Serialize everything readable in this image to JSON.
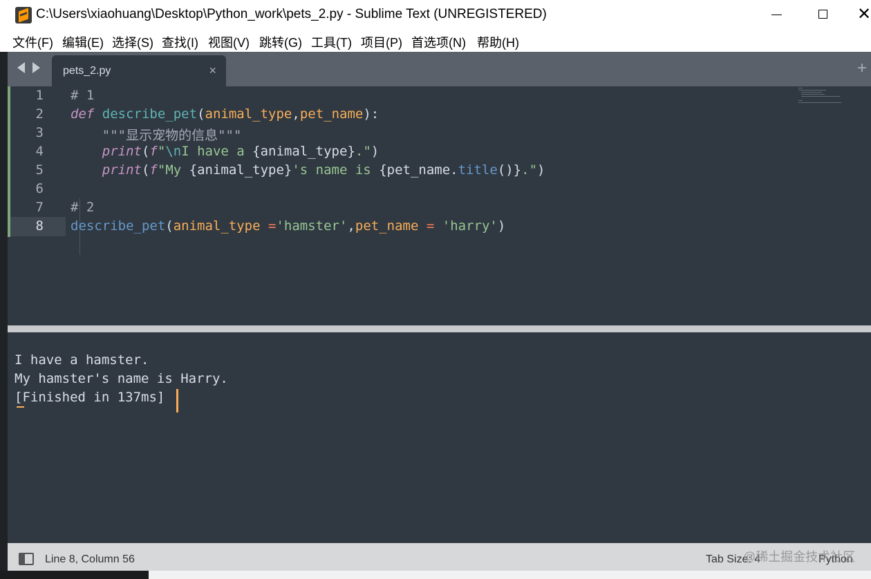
{
  "window": {
    "title": "C:\\Users\\xiaohuang\\Desktop\\Python_work\\pets_2.py - Sublime Text (UNREGISTERED)",
    "minimize_glyph": "—",
    "maximize_glyph": "□",
    "close_glyph": "✕"
  },
  "menu": [
    "文件(F)",
    "编辑(E)",
    "选择(S)",
    "查找(I)",
    "视图(V)",
    "跳转(G)",
    "工具(T)",
    "项目(P)",
    "首选项(N)",
    "帮助(H)"
  ],
  "tabs": {
    "active_label": "pets_2.py",
    "close_glyph": "×",
    "new_tab_glyph": "+"
  },
  "editor": {
    "line_numbers": [
      "1",
      "2",
      "3",
      "4",
      "5",
      "6",
      "7",
      "8"
    ],
    "active_line": 8,
    "lines": [
      [
        {
          "t": "# 1",
          "c": "cmt"
        }
      ],
      [
        {
          "t": "def",
          "c": "def"
        },
        {
          "t": " ",
          "c": "plain"
        },
        {
          "t": "describe_pet",
          "c": "fn"
        },
        {
          "t": "(",
          "c": "plain"
        },
        {
          "t": "animal_type",
          "c": "arg"
        },
        {
          "t": ",",
          "c": "plain"
        },
        {
          "t": "pet_name",
          "c": "arg"
        },
        {
          "t": "):",
          "c": "plain"
        }
      ],
      [
        {
          "t": "    \"\"\"显示宠物的信息\"\"\"",
          "c": "cmt"
        }
      ],
      [
        {
          "t": "    ",
          "c": "plain"
        },
        {
          "t": "print",
          "c": "print"
        },
        {
          "t": "(",
          "c": "plain"
        },
        {
          "t": "f",
          "c": "f"
        },
        {
          "t": "\"",
          "c": "str"
        },
        {
          "t": "\\n",
          "c": "esc"
        },
        {
          "t": "I have a ",
          "c": "str"
        },
        {
          "t": "{animal_type}",
          "c": "ph"
        },
        {
          "t": ".\"",
          "c": "str"
        },
        {
          "t": ")",
          "c": "plain"
        }
      ],
      [
        {
          "t": "    ",
          "c": "plain"
        },
        {
          "t": "print",
          "c": "print"
        },
        {
          "t": "(",
          "c": "plain"
        },
        {
          "t": "f",
          "c": "f"
        },
        {
          "t": "\"My ",
          "c": "str"
        },
        {
          "t": "{animal_type}",
          "c": "ph"
        },
        {
          "t": "'s name is ",
          "c": "str"
        },
        {
          "t": "{pet_name.",
          "c": "ph"
        },
        {
          "t": "title",
          "c": "meth"
        },
        {
          "t": "()}",
          "c": "ph"
        },
        {
          "t": ".\"",
          "c": "str"
        },
        {
          "t": ")",
          "c": "plain"
        }
      ],
      [],
      [
        {
          "t": "# 2",
          "c": "cmt"
        }
      ],
      [
        {
          "t": "describe_pet",
          "c": "meth"
        },
        {
          "t": "(",
          "c": "plain"
        },
        {
          "t": "animal_type",
          "c": "arg"
        },
        {
          "t": " ",
          "c": "plain"
        },
        {
          "t": "=",
          "c": "op"
        },
        {
          "t": "'hamster'",
          "c": "str"
        },
        {
          "t": ",",
          "c": "plain"
        },
        {
          "t": "pet_name",
          "c": "arg"
        },
        {
          "t": " ",
          "c": "plain"
        },
        {
          "t": "=",
          "c": "op"
        },
        {
          "t": " ",
          "c": "plain"
        },
        {
          "t": "'harry'",
          "c": "str"
        },
        {
          "t": ")",
          "c": "plain"
        }
      ]
    ]
  },
  "output": {
    "lines": [
      "I have a hamster.",
      "My hamster's name is Harry.",
      "[Finished in 137ms]"
    ]
  },
  "status": {
    "position": "Line 8, Column 56",
    "tab_size": "Tab Size: 4",
    "syntax": "Python",
    "watermark": "@稀土掘金技术社区"
  },
  "colors": {
    "editor_bg": "#303841",
    "tabbar_bg": "#5a616a",
    "accent_cursor": "#f9ae58",
    "keyword": "#c695c6",
    "function": "#5fb4b4",
    "argument": "#f9ae58",
    "string": "#99c794",
    "comment": "#a6acb9",
    "operator": "#f97b58",
    "method": "#6699cc"
  },
  "icons": {
    "app": "sublime-text-icon",
    "nav_back": "triangle-left-icon",
    "nav_forward": "triangle-right-icon",
    "panel_toggle": "panel-toggle-icon"
  }
}
